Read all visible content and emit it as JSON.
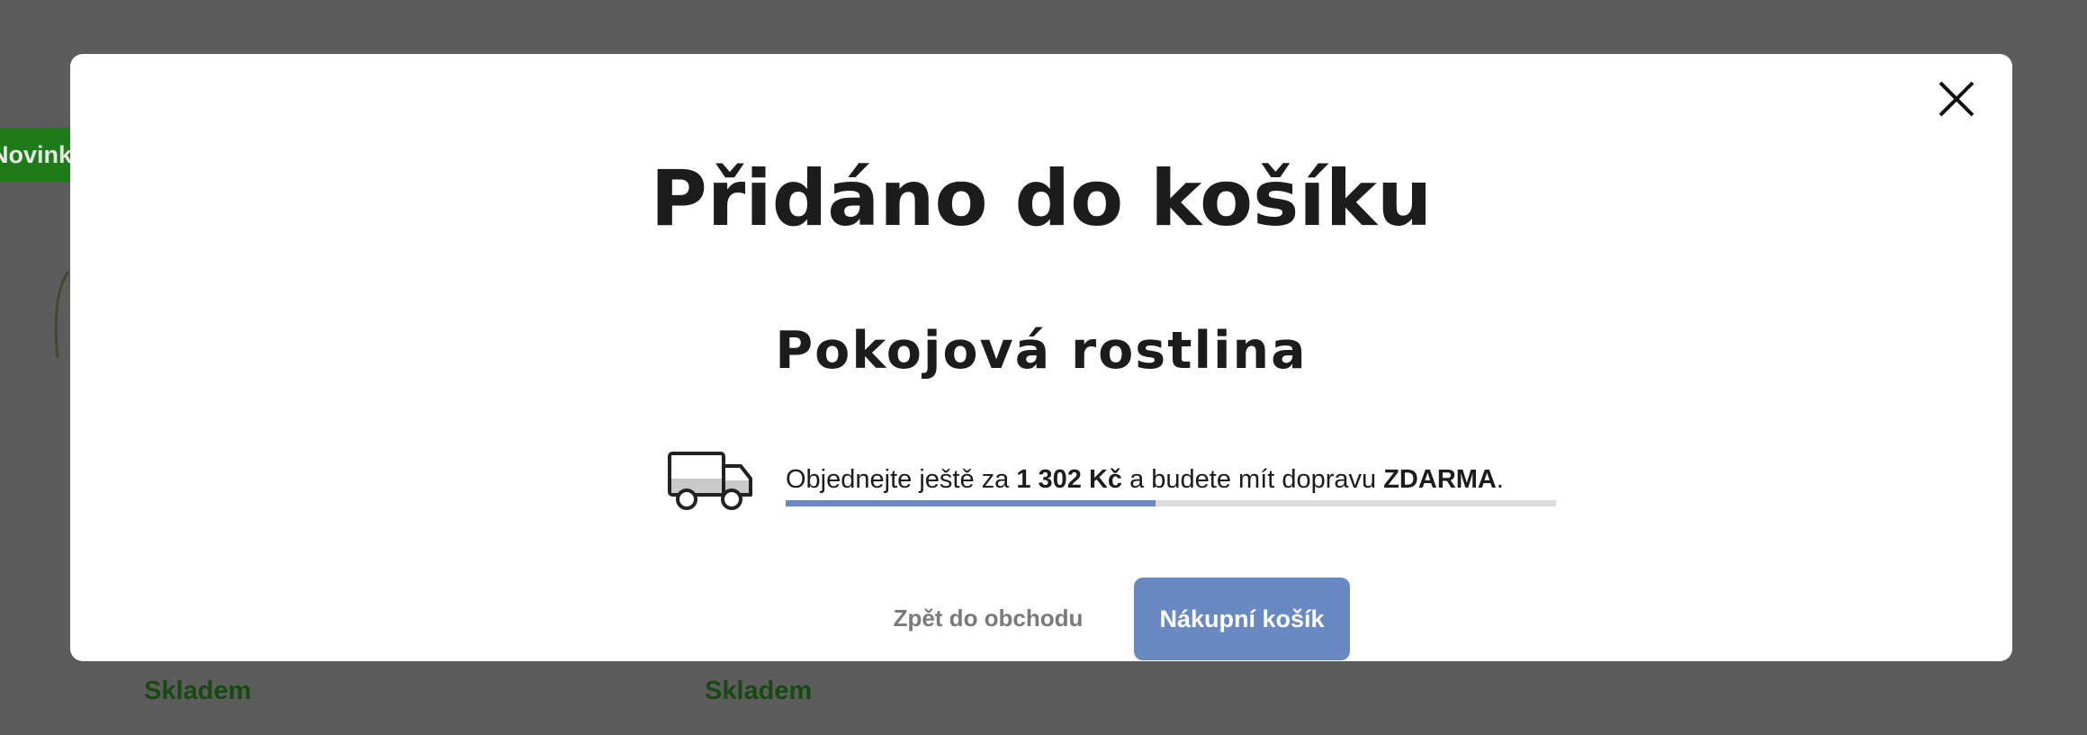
{
  "background": {
    "badge_label": "Novinka",
    "stock_labels": [
      "Skladem",
      "Skladem"
    ]
  },
  "modal": {
    "title": "Přidáno do košíku",
    "product_name": "Pokojová rostlina",
    "shipping": {
      "text_before": "Objednejte ještě za ",
      "amount": "1 302 Kč",
      "text_middle": " a budete mít dopravu ",
      "free_label": "ZDARMA",
      "text_after": ".",
      "progress_fraction": 0.48,
      "icon": "truck-icon"
    },
    "back_label": "Zpět do obchodu",
    "cart_label": "Nákupní košík",
    "close_icon": "close-icon"
  },
  "colors": {
    "accent": "#6a88c2",
    "overlay": "#5c5c5c",
    "badge": "#1f7a1a",
    "stock": "#174a11"
  }
}
